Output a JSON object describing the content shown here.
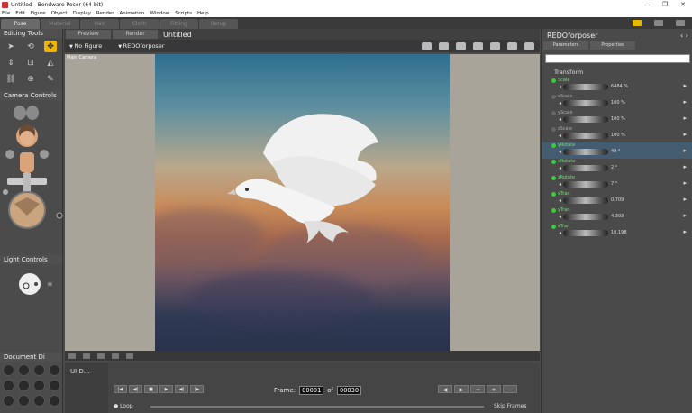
{
  "window": {
    "title": "Untitled - Bondware Poser (64-bit)",
    "controls": [
      "—",
      "❐",
      "✕"
    ]
  },
  "menu": [
    "File",
    "Edit",
    "Figure",
    "Object",
    "Display",
    "Render",
    "Animation",
    "Window",
    "Scripts",
    "Help"
  ],
  "rooms": [
    "Pose",
    "Material",
    "Hair",
    "Cloth",
    "Fitting",
    "Setup"
  ],
  "active_room": "Pose",
  "left_panel": {
    "editing_tools": "Editing Tools",
    "camera_controls": "Camera Controls",
    "light_controls": "Light Controls",
    "document_display": "Document Di"
  },
  "viewport": {
    "tabs": [
      "Preview",
      "Render"
    ],
    "document_name": "Untitled",
    "figure_select": "No Figure",
    "actor_select": "REDOforposer",
    "camera_label": "Main Camera"
  },
  "timeline": {
    "ui_dock": "UI D...",
    "frame_label": "Frame:",
    "current_frame": "00001",
    "of": "of",
    "total_frames": "00030",
    "loop": "Loop",
    "skip_frames": "Skip Frames",
    "transport": [
      "|◀",
      "◀|",
      "■",
      "▶",
      "◀|",
      "|▶"
    ],
    "keyframe_buttons": [
      "◀",
      "▶",
      "⊸",
      "+",
      "−"
    ]
  },
  "right_panel": {
    "actor": "REDOforposer",
    "tabs": [
      "Parameters",
      "Properties"
    ],
    "group": "Transform",
    "params": [
      {
        "name": "Scale",
        "value": "6484 %",
        "active": true
      },
      {
        "name": "xScale",
        "value": "100 %",
        "active": false
      },
      {
        "name": "yScale",
        "value": "100 %",
        "active": false
      },
      {
        "name": "zScale",
        "value": "100 %",
        "active": false
      },
      {
        "name": "yRotate",
        "value": "49 °",
        "active": true
      },
      {
        "name": "xRotate",
        "value": "2 °",
        "active": true
      },
      {
        "name": "zRotate",
        "value": "7 °",
        "active": true
      },
      {
        "name": "xTran",
        "value": "0.709",
        "active": true
      },
      {
        "name": "yTran",
        "value": "4.303",
        "active": true
      },
      {
        "name": "zTran",
        "value": "10.198",
        "active": true
      }
    ],
    "highlighted_param": "yRotate"
  }
}
